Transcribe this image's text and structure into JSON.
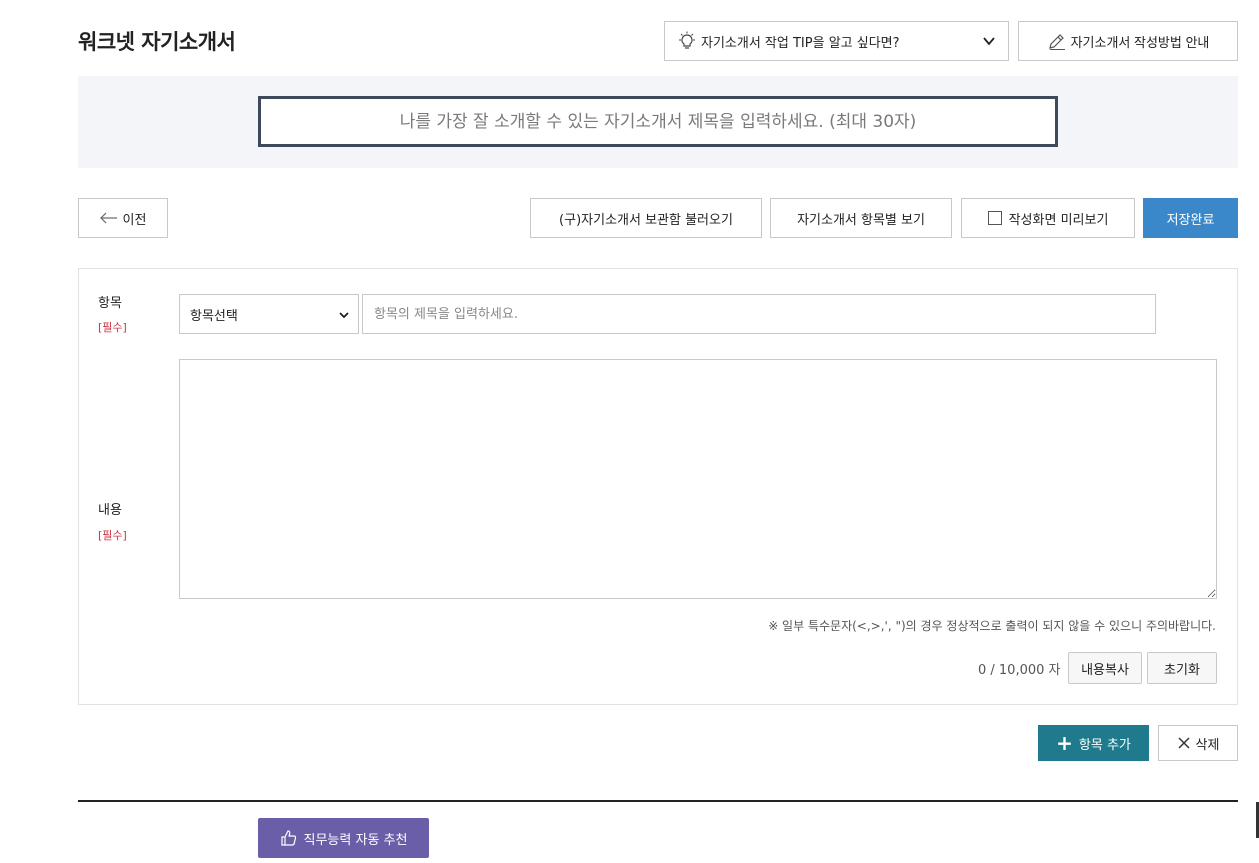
{
  "header": {
    "title": "워크넷 자기소개서",
    "tip_dropdown_label": "자기소개서 작업 TIP을 알고 싶다면?",
    "guide_button_label": "자기소개서 작성방법 안내"
  },
  "title_input": {
    "placeholder": "나를 가장 잘 소개할 수 있는 자기소개서 제목을 입력하세요. (최대 30자)"
  },
  "toolbar": {
    "prev_label": "이전",
    "load_label": "(구)자기소개서 보관함 불러오기",
    "view_items_label": "자기소개서 항목별 보기",
    "preview_label": "작성화면 미리보기",
    "save_label": "저장완료"
  },
  "form": {
    "item_label": "항목",
    "content_label": "내용",
    "required_tag": "[필수]",
    "item_select_value": "항목선택",
    "item_title_placeholder": "항목의 제목을 입력하세요.",
    "notice": "※ 일부 특수문자(<,>,', \")의 경우 정상적으로 출력이 되지 않을 수 있으니 주의바랍니다.",
    "char_count": "0 / 10,000 자",
    "copy_label": "내용복사",
    "reset_label": "초기화"
  },
  "actions": {
    "add_label": "항목 추가",
    "delete_label": "삭제"
  },
  "recommend": {
    "label": "직무능력 자동 추천"
  },
  "colors": {
    "save_button": "#3a87c9",
    "add_button": "#1e7a8c",
    "recommend_button": "#6b5ea8",
    "required": "#d0303f",
    "title_border": "#3e4a5c"
  }
}
